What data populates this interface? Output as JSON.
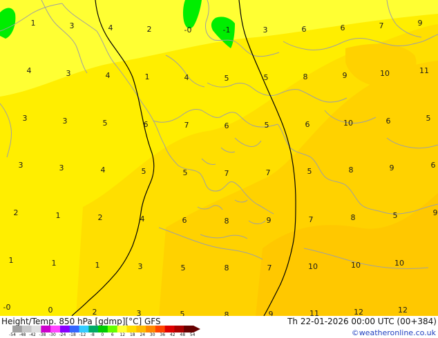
{
  "map": {
    "values": [
      {
        "t": "1"
      },
      {
        "t": "3"
      },
      {
        "t": "4"
      },
      {
        "t": "2"
      },
      {
        "t": "-0"
      },
      {
        "t": "-1"
      },
      {
        "t": "3"
      },
      {
        "t": "6"
      },
      {
        "t": "6"
      },
      {
        "t": "7"
      },
      {
        "t": "9"
      },
      {
        "t": "4"
      },
      {
        "t": "3"
      },
      {
        "t": "4"
      },
      {
        "t": "1"
      },
      {
        "t": "4"
      },
      {
        "t": "5"
      },
      {
        "t": "5"
      },
      {
        "t": "8"
      },
      {
        "t": "9"
      },
      {
        "t": "10"
      },
      {
        "t": "11"
      },
      {
        "t": "3"
      },
      {
        "t": "3"
      },
      {
        "t": "5"
      },
      {
        "t": "6"
      },
      {
        "t": "7"
      },
      {
        "t": "6"
      },
      {
        "t": "5"
      },
      {
        "t": "6"
      },
      {
        "t": "10"
      },
      {
        "t": "6"
      },
      {
        "t": "5"
      },
      {
        "t": "3"
      },
      {
        "t": "3"
      },
      {
        "t": "4"
      },
      {
        "t": "5"
      },
      {
        "t": "5"
      },
      {
        "t": "7"
      },
      {
        "t": "7"
      },
      {
        "t": "5"
      },
      {
        "t": "8"
      },
      {
        "t": "9"
      },
      {
        "t": "6"
      },
      {
        "t": "2"
      },
      {
        "t": "1"
      },
      {
        "t": "2"
      },
      {
        "t": "4"
      },
      {
        "t": "6"
      },
      {
        "t": "8"
      },
      {
        "t": "9"
      },
      {
        "t": "7"
      },
      {
        "t": "8"
      },
      {
        "t": "5"
      },
      {
        "t": "9"
      },
      {
        "t": "1"
      },
      {
        "t": "1"
      },
      {
        "t": "1"
      },
      {
        "t": "3"
      },
      {
        "t": "5"
      },
      {
        "t": "8"
      },
      {
        "t": "7"
      },
      {
        "t": "10"
      },
      {
        "t": "10"
      },
      {
        "t": "10"
      },
      {
        "t": "-0"
      },
      {
        "t": "0"
      },
      {
        "t": "2"
      },
      {
        "t": "3"
      },
      {
        "t": "5"
      },
      {
        "t": "8"
      },
      {
        "t": "9"
      },
      {
        "t": "11"
      },
      {
        "t": "12"
      },
      {
        "t": "12"
      }
    ],
    "colors": {
      "base": "#ffff33",
      "warm1": "#ffea00",
      "warm2": "#ffd800",
      "warm3": "#ffc700",
      "cold": "#00ee00",
      "coast": "#a0a0a0",
      "contour": "#000000"
    }
  },
  "footer": {
    "title": "Height/Temp. 850 hPa [gdmp][°C] GFS",
    "datetime": "Th 22-01-2026 00:00 UTC (00+384)",
    "credit": "©weatheronline.co.uk",
    "scale_ticks": [
      "-54",
      "-48",
      "-42",
      "-38",
      "-30",
      "-24",
      "-18",
      "-12",
      "-8",
      "0",
      "6",
      "12",
      "18",
      "24",
      "30",
      "36",
      "42",
      "48",
      "54"
    ],
    "scale_colors": [
      "#a0a0a0",
      "#c8c8c8",
      "#e0e0e0",
      "#cc00cc",
      "#ff44ff",
      "#8800ff",
      "#3366ff",
      "#33ccff",
      "#00aa66",
      "#00cc00",
      "#66ff00",
      "#ffff33",
      "#ffdd00",
      "#ffbb00",
      "#ff8800",
      "#ff4400",
      "#dd0000",
      "#aa0000",
      "#660000"
    ]
  }
}
